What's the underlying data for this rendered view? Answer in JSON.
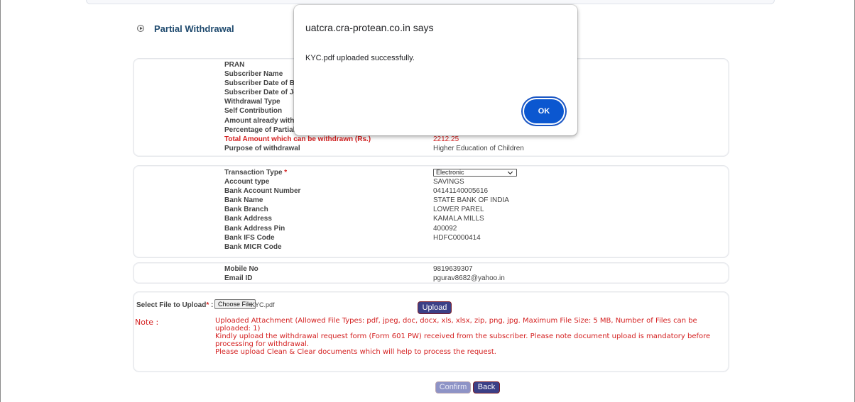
{
  "page": {
    "title": "Partial Withdrawal"
  },
  "subscriber_section": [
    {
      "label": "PRAN",
      "value": ""
    },
    {
      "label": "Subscriber Name",
      "value": ""
    },
    {
      "label": "Subscriber Date of Bi",
      "value": ""
    },
    {
      "label": "Subscriber Date of Jo",
      "value": ""
    },
    {
      "label": "Withdrawal Type",
      "value": ""
    },
    {
      "label": "Self Contribution",
      "value": ""
    },
    {
      "label": "Amount already witho",
      "value": ""
    },
    {
      "label": "Percentage of Partial W",
      "value": ""
    },
    {
      "label": "Total Amount which can be withdrawn (Rs.)",
      "value": "2212.25"
    },
    {
      "label": "Purpose of withdrawal",
      "value": "Higher Education of Children"
    }
  ],
  "bank_section": {
    "transaction_type": {
      "label": "Transaction Type",
      "required_mark": "*",
      "selected": "Electronic"
    },
    "rows": [
      {
        "label": "Account type",
        "value": "SAVINGS"
      },
      {
        "label": "Bank Account Number",
        "value": "04141140005616"
      },
      {
        "label": "Bank Name",
        "value": "STATE BANK OF INDIA"
      },
      {
        "label": "Bank Branch",
        "value": "LOWER PAREL"
      },
      {
        "label": "Bank Address",
        "value": "KAMALA MILLS"
      },
      {
        "label": "Bank Address Pin",
        "value": "400092"
      },
      {
        "label": "Bank IFS Code",
        "value": "HDFC0000414"
      },
      {
        "label": "Bank MICR Code",
        "value": ""
      }
    ]
  },
  "contact_section": [
    {
      "label": "Mobile No",
      "value": "9819639307"
    },
    {
      "label": "Email ID",
      "value": "pgurav8682@yahoo.in"
    }
  ],
  "upload_section": {
    "label": "Select File to Upload",
    "required_mark": "*",
    "colon": " :",
    "choose_file_label": "Choose File",
    "file_name": "KYC.pdf",
    "upload_label": "Upload",
    "note_label": "Note :",
    "notes": [
      "Uploaded Attachment (Allowed File Types: pdf, jpeg, doc, docx, xls, xlsx, zip, png, jpg. Maximum File Size: 5 MB, Number of Files can be uploaded: 1)",
      "Kindly upload the withdrawal request form (Form 601 PW) received from the subscriber. Please note document upload is mandatory before processing for withdrawal.",
      "Please upload Clean & Clear documents which will help to process the request."
    ]
  },
  "actions": {
    "confirm_label": "Confirm",
    "back_label": "Back"
  },
  "dialog": {
    "title": "uatcra.cra-protean.co.in says",
    "message": "KYC.pdf uploaded successfully.",
    "ok_label": "OK"
  },
  "colors": {
    "label_text": "#444444",
    "highlight_red": "#d42020",
    "title_blue": "#1f4a6e",
    "button_navy": "#3b3f86",
    "dialog_ok_blue": "#0b57d0"
  }
}
